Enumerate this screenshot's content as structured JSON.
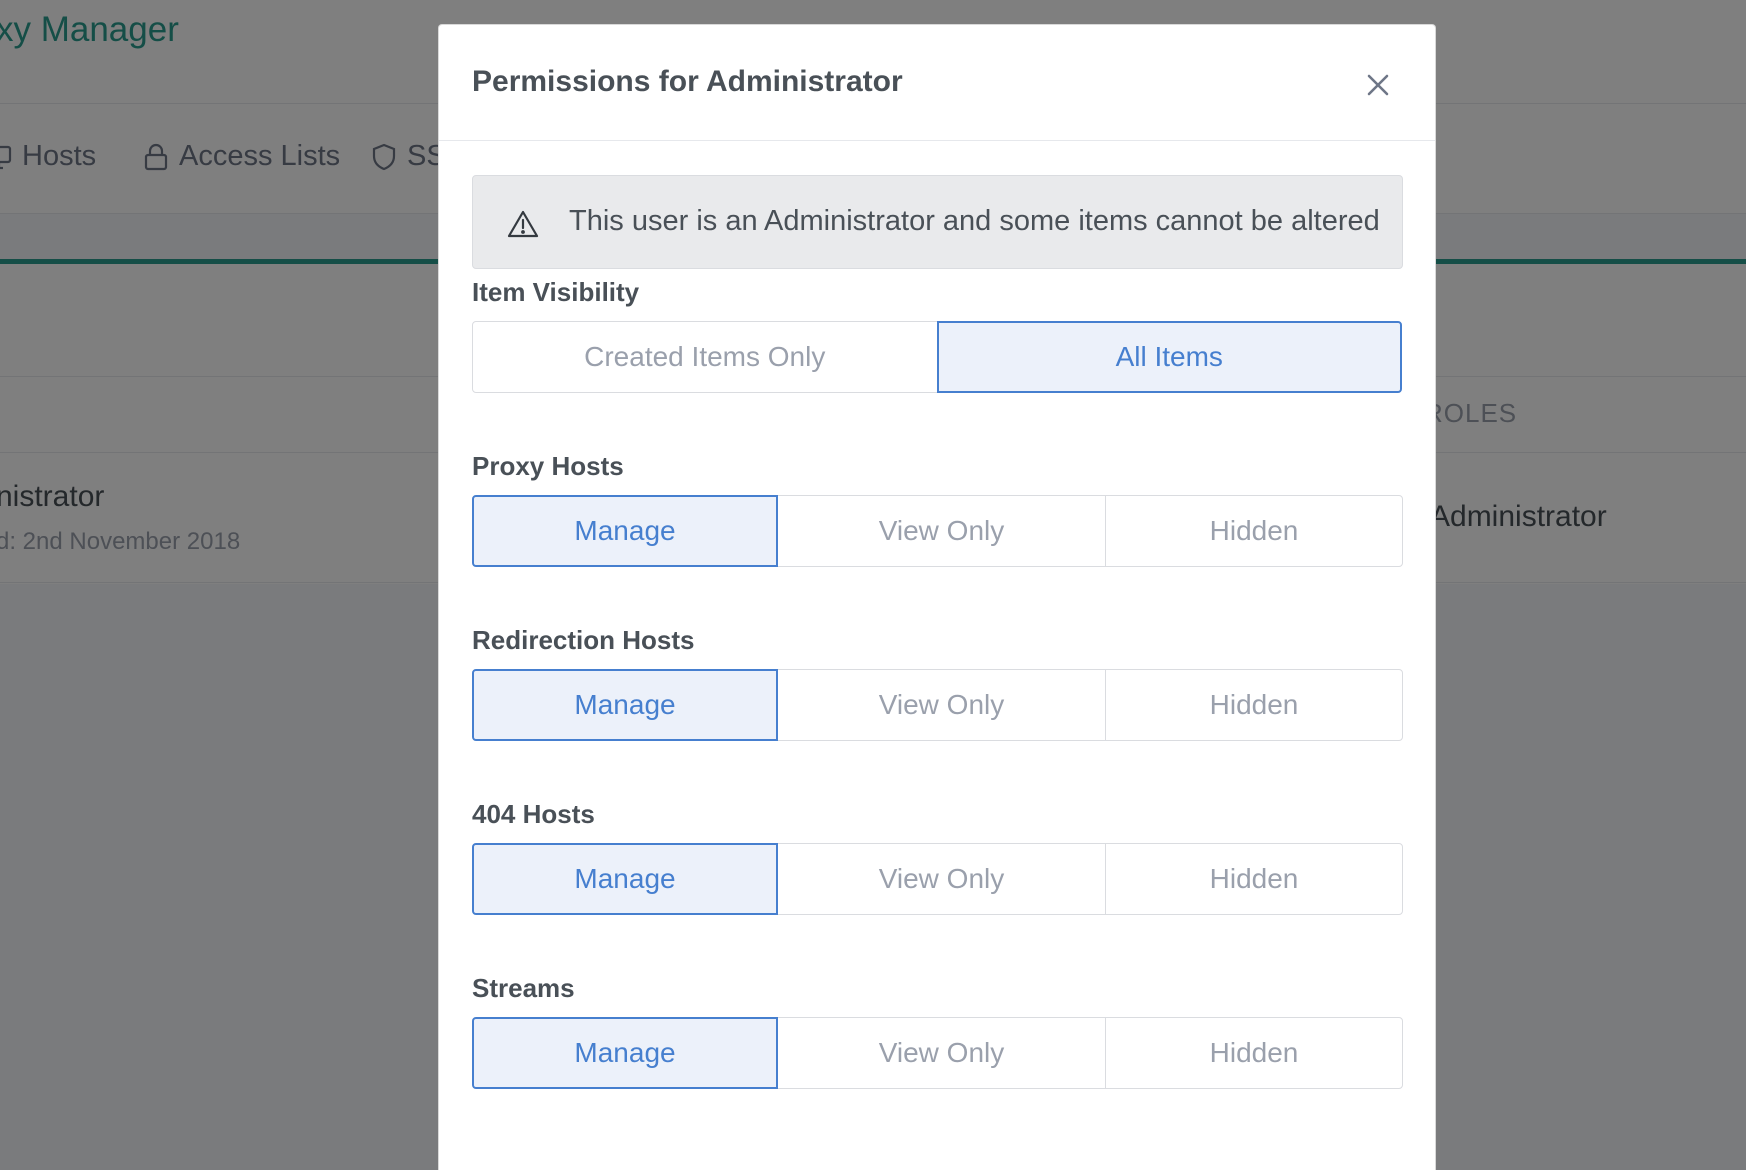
{
  "background": {
    "brand": "xy Manager",
    "nav": [
      {
        "label": "Hosts",
        "icon": "monitor-icon"
      },
      {
        "label": "Access Lists",
        "icon": "lock-icon"
      },
      {
        "label": "SS",
        "icon": "shield-icon"
      }
    ],
    "table": {
      "roles_header": "ROLES",
      "user_name": "nistrator",
      "user_created": "d: 2nd November 2018",
      "user_role": "Administrator"
    }
  },
  "modal": {
    "title": "Permissions for Administrator",
    "close_icon": "close-icon",
    "alert": {
      "icon": "warning-triangle-icon",
      "text": "This user is an Administrator and some items cannot be altered"
    },
    "visibility": {
      "label": "Item Visibility",
      "options": [
        "Created Items Only",
        "All Items"
      ],
      "selected": "All Items"
    },
    "permissions": [
      {
        "label": "Proxy Hosts",
        "options": [
          "Manage",
          "View Only",
          "Hidden"
        ],
        "selected": "Manage"
      },
      {
        "label": "Redirection Hosts",
        "options": [
          "Manage",
          "View Only",
          "Hidden"
        ],
        "selected": "Manage"
      },
      {
        "label": "404 Hosts",
        "options": [
          "Manage",
          "View Only",
          "Hidden"
        ],
        "selected": "Manage"
      },
      {
        "label": "Streams",
        "options": [
          "Manage",
          "View Only",
          "Hidden"
        ],
        "selected": "Manage"
      }
    ]
  },
  "colors": {
    "accent": "#467fcf",
    "brand": "#2a9d8f",
    "overlay": "rgba(0,0,0,0.5)"
  }
}
